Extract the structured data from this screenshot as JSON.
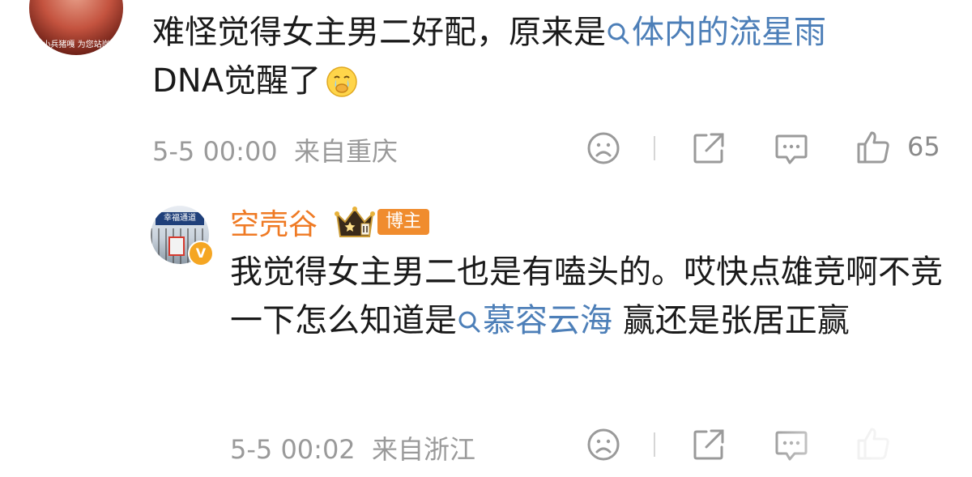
{
  "comment1": {
    "avatar_caption": "小兵猪嘎 为您站岗",
    "text_before": "难怪觉得女主男二好配，原来是",
    "topic": "体内的流星雨",
    "text_after": "DNA觉醒了",
    "emoji": "crying-face-emoji",
    "time": "5-5 00:00",
    "location": "来自重庆",
    "like_count": "65"
  },
  "reply": {
    "avatar_sign": "幸福通道",
    "verified_badge": "V",
    "username": "空壳谷",
    "role_tag": "博主",
    "text_before": "我觉得女主男二也是有嗑头的。哎快点雄竞啊不竞一下怎么知道是",
    "topic": "慕容云海",
    "text_after": " 赢还是张居正赢",
    "time": "5-5 00:02",
    "location": "来自浙江"
  },
  "colors": {
    "topic_link": "#4d7fb8",
    "username": "#ef7a24",
    "meta": "#9a9a9a",
    "tag_bg": "#f08c2e"
  },
  "icons": [
    "sad-face-icon",
    "share-icon",
    "comment-icon",
    "thumbs-up-icon",
    "crown-rank-icon",
    "search-icon"
  ]
}
